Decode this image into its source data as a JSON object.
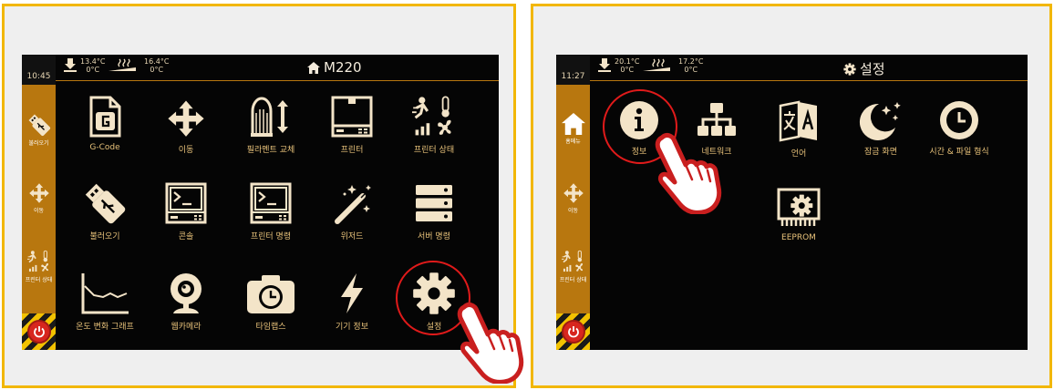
{
  "colors": {
    "frame": "#f2b705",
    "sidebar": "#b8770f",
    "icon": "#f3e4c8",
    "label": "#e8c27a",
    "highlight": "#e01a1a"
  },
  "left": {
    "time": "10:45",
    "temp1": {
      "current": "13.4°C",
      "target": "0°C"
    },
    "temp2": {
      "current": "16.4°C",
      "target": "0°C"
    },
    "title": "M220",
    "sidebar": {
      "load": "불러오기",
      "move": "이동",
      "status": "프린터 상태"
    },
    "grid": [
      {
        "label": "G-Code",
        "icon": "gcode-file-icon"
      },
      {
        "label": "이동",
        "icon": "move-arrows-icon"
      },
      {
        "label": "필라멘트 교체",
        "icon": "filament-change-icon"
      },
      {
        "label": "프린터",
        "icon": "printer-icon"
      },
      {
        "label": "프린터 상태",
        "icon": "printer-status-icon"
      },
      {
        "label": "불러오기",
        "icon": "usb-icon"
      },
      {
        "label": "콘솔",
        "icon": "console-icon"
      },
      {
        "label": "프린터 명령",
        "icon": "printer-command-icon"
      },
      {
        "label": "위저드",
        "icon": "magic-wand-icon"
      },
      {
        "label": "서버 명령",
        "icon": "server-icon"
      },
      {
        "label": "온도 변화 그래프",
        "icon": "temperature-graph-icon"
      },
      {
        "label": "웹카메라",
        "icon": "webcam-icon"
      },
      {
        "label": "타임랩스",
        "icon": "timelapse-camera-icon"
      },
      {
        "label": "기기 정보",
        "icon": "lightning-icon"
      },
      {
        "label": "설정",
        "icon": "gear-icon"
      }
    ]
  },
  "right": {
    "time": "11:27",
    "temp1": {
      "current": "20.1°C",
      "target": "0°C"
    },
    "temp2": {
      "current": "17.2°C",
      "target": "0°C"
    },
    "title": "설정",
    "sidebar": {
      "home": "홈메뉴",
      "move": "이동",
      "status": "프린터 상태"
    },
    "grid": [
      {
        "label": "정보",
        "icon": "info-icon"
      },
      {
        "label": "네트워크",
        "icon": "network-icon"
      },
      {
        "label": "언어",
        "icon": "language-icon"
      },
      {
        "label": "잠금 화면",
        "icon": "moon-stars-icon"
      },
      {
        "label": "시간 & 파일 형식",
        "icon": "clock-icon"
      },
      {
        "label": "EEPROM",
        "icon": "eeprom-chip-icon"
      }
    ]
  }
}
